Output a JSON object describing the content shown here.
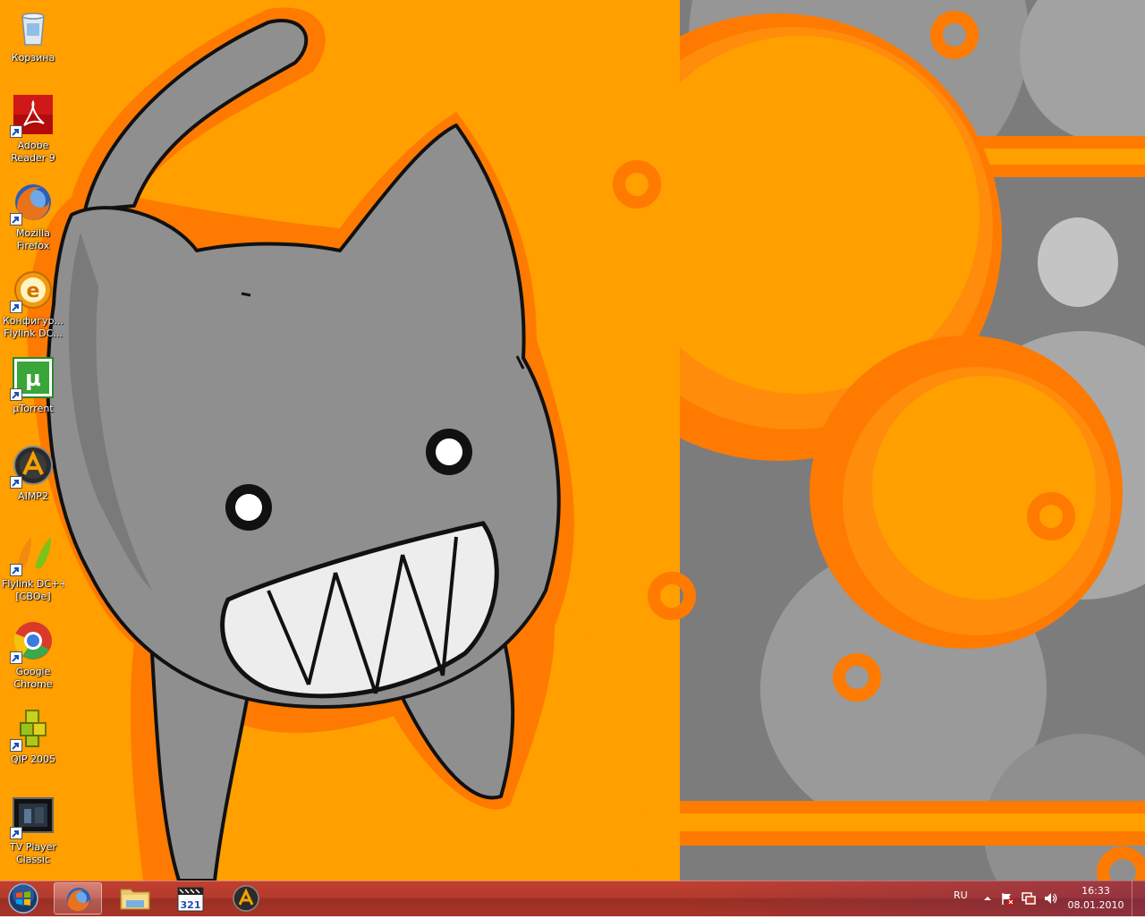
{
  "desktop": {
    "icons": [
      {
        "label": "Корзина",
        "icon": "recycle-bin-icon",
        "shortcut": false
      },
      {
        "label": "Adobe\nReader 9",
        "line1": "Adobe",
        "line2": "Reader 9",
        "icon": "adobe-reader-icon",
        "shortcut": true
      },
      {
        "line1": "Mozilla",
        "line2": "Firefox",
        "icon": "firefox-icon",
        "shortcut": true
      },
      {
        "line1": "Конфигур...",
        "line2": "Flylink DC...",
        "icon": "flylink-config-icon",
        "shortcut": true
      },
      {
        "line1": "µTorrent",
        "line2": "",
        "icon": "utorrent-icon",
        "shortcut": true
      },
      {
        "line1": "AIMP2",
        "line2": "",
        "icon": "aimp-icon",
        "shortcut": true
      },
      {
        "line1": "Flylink DC++",
        "line2": "[СВОе]",
        "icon": "flylink-icon",
        "shortcut": true
      },
      {
        "line1": "Google",
        "line2": "Chrome",
        "icon": "chrome-icon",
        "shortcut": true
      },
      {
        "line1": "QIP 2005",
        "line2": "",
        "icon": "qip-icon",
        "shortcut": true
      },
      {
        "line1": "TV Player",
        "line2": "Classic",
        "icon": "tv-player-icon",
        "shortcut": true
      }
    ]
  },
  "taskbar": {
    "pinned": [
      {
        "name": "firefox",
        "icon": "firefox-icon",
        "active": true
      },
      {
        "name": "explorer",
        "icon": "folder-icon",
        "active": false
      },
      {
        "name": "media-player-classic",
        "icon": "media-player-classic-icon",
        "active": false
      },
      {
        "name": "aimp",
        "icon": "aimp-icon",
        "active": false
      }
    ],
    "tray": {
      "language": "RU",
      "time": "16:33",
      "date": "08.01.2010"
    }
  },
  "colors": {
    "wallpaper_orange": "#ff9f00",
    "wallpaper_dark_orange": "#ff7a00",
    "wallpaper_gray": "#8a8a8a",
    "taskbar": "#b33a2c"
  }
}
